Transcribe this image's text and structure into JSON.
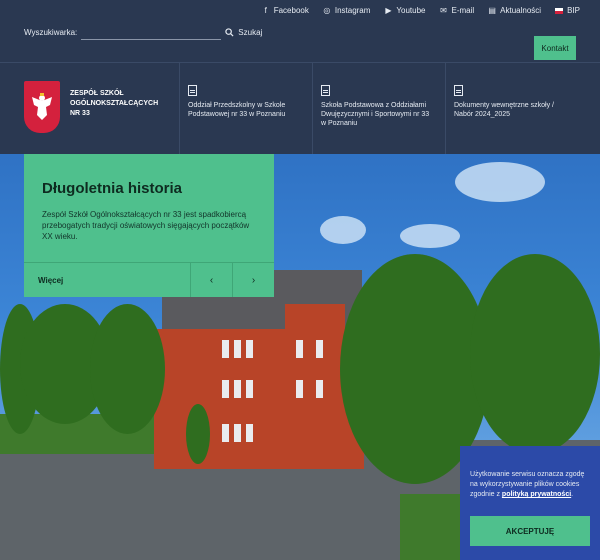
{
  "social": [
    {
      "label": "Facebook",
      "icon": "facebook-icon"
    },
    {
      "label": "Instagram",
      "icon": "instagram-icon"
    },
    {
      "label": "Youtube",
      "icon": "youtube-icon"
    },
    {
      "label": "E-mail",
      "icon": "mail-icon"
    },
    {
      "label": "Aktualności",
      "icon": "news-icon"
    },
    {
      "label": "BIP",
      "icon": "flag-icon"
    }
  ],
  "search": {
    "label": "Wyszukiwarka:",
    "value": "",
    "button_label": "Szukaj"
  },
  "contact_label": "Kontakt",
  "brand": {
    "line1": "ZESPÓŁ SZKÓŁ",
    "line2": "OGÓLNOKSZTAŁCĄCYCH",
    "line3": "NR 33"
  },
  "nav": [
    {
      "label": "Oddział Przedszkolny w Szkole Podstawowej nr 33 w Poznaniu"
    },
    {
      "label": "Szkoła Podstawowa z Oddziałami Dwujęzycznymi i Sportowymi nr 33 w Poznaniu"
    },
    {
      "label": "Dokumenty wewnętrzne szkoły / Nabór 2024_2025"
    }
  ],
  "hero": {
    "title": "Długoletnia historia",
    "text": "Zespół Szkół Ogólnokształcących nr 33 jest spadkobiercą przebogatych tradycji oświatowych sięgających początków XX wieku.",
    "more_label": "Więcej",
    "prev_label": "‹",
    "next_label": "›"
  },
  "cookie": {
    "text_before": "Użytkowanie serwisu oznacza zgodę na wykorzystywanie plików cookies zgodnie z ",
    "link_label": "polityką prywatności",
    "text_after": ".",
    "accept_label": "AKCEPTUJĘ"
  },
  "colors": {
    "accent": "#4fc08d",
    "navy": "#2a3851",
    "cookie_bg": "#2c4aa8"
  }
}
